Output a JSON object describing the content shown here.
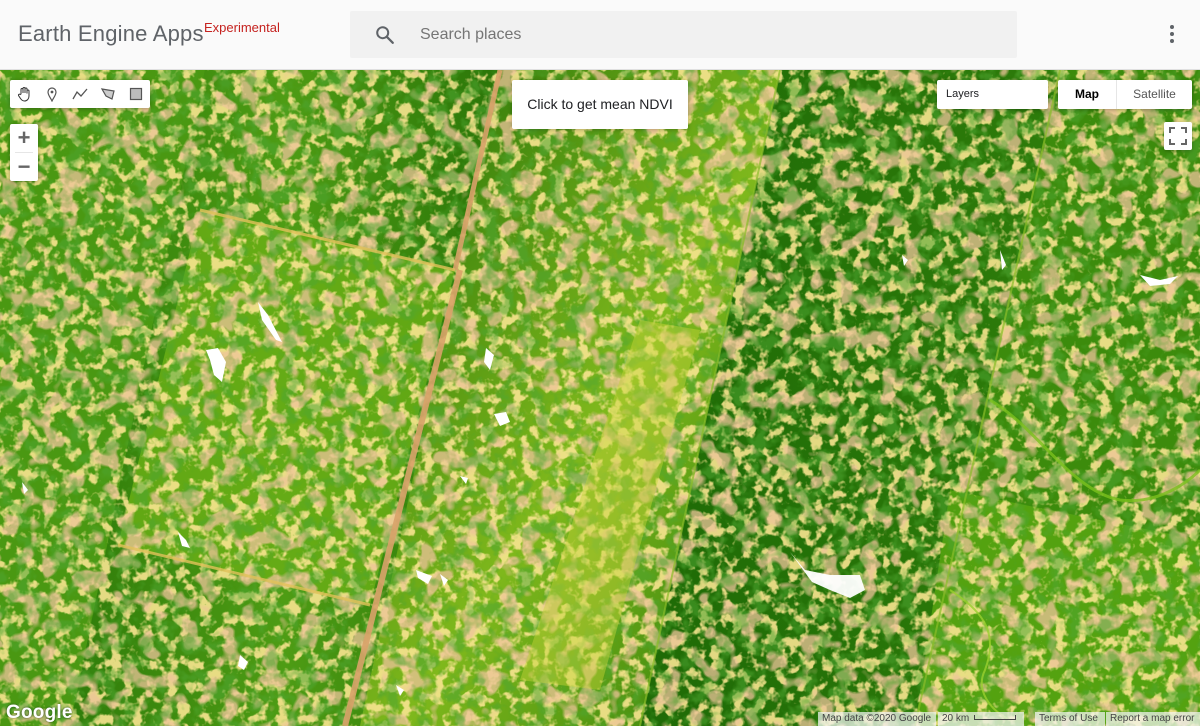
{
  "app": {
    "title": "Earth Engine Apps",
    "badge": "Experimental"
  },
  "search": {
    "placeholder": "Search places",
    "icon": "search-icon"
  },
  "header": {
    "menu_icon": "more-vert-icon"
  },
  "map": {
    "drawing_tools": [
      {
        "name": "hand-tool",
        "icon": "hand-icon"
      },
      {
        "name": "point-tool",
        "icon": "marker-icon"
      },
      {
        "name": "line-tool",
        "icon": "polyline-icon"
      },
      {
        "name": "polygon-tool",
        "icon": "polygon-icon"
      },
      {
        "name": "rectangle-tool",
        "icon": "rectangle-icon"
      }
    ],
    "zoom_in_label": "+",
    "zoom_out_label": "−",
    "ndvi_panel_text": "Click to get mean NDVI",
    "layers_label": "Layers",
    "map_type": {
      "map_label": "Map",
      "satellite_label": "Satellite",
      "selected": "Map"
    },
    "google_logo": "Google",
    "attribution": {
      "map_data": "Map data ©2020 Google",
      "scale": "20 km",
      "terms": "Terms of Use",
      "report": "Report a map error"
    },
    "colors": {
      "dense_vegetation": "#1e6b06",
      "mid_vegetation": "#4a9a12",
      "light_vegetation": "#8cc21c",
      "sparse": "#e8c23a",
      "bare": "#d99a5a",
      "water": "#ffffff"
    }
  }
}
